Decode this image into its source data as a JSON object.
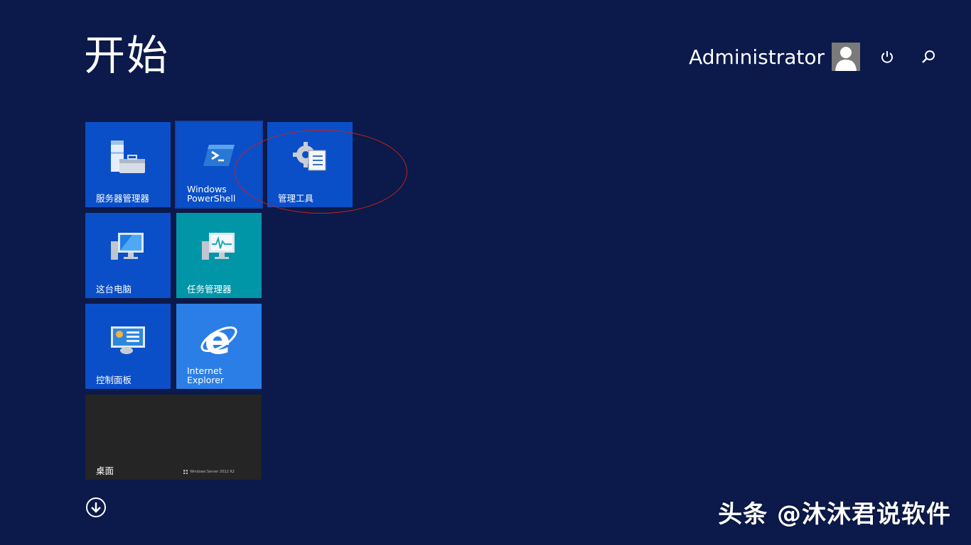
{
  "header": {
    "title": "开始",
    "username": "Administrator"
  },
  "tiles": [
    {
      "label": "服务器管理器",
      "icon": "server-manager-icon"
    },
    {
      "label": "Windows\nPowerShell",
      "icon": "powershell-icon"
    },
    {
      "label": "管理工具",
      "icon": "admin-tools-icon"
    },
    {
      "label": "这台电脑",
      "icon": "this-pc-icon"
    },
    {
      "label": "任务管理器",
      "icon": "task-manager-icon"
    },
    {
      "label": "控制面板",
      "icon": "control-panel-icon"
    },
    {
      "label": "Internet\nExplorer",
      "icon": "internet-explorer-icon"
    },
    {
      "label": "桌面",
      "badge": "Windows Server 2012 R2"
    }
  ],
  "watermark": "头条 @沐沐君说软件",
  "colors": {
    "background": "#0b1a4a",
    "tile_blue": "#0a4fc8",
    "tile_teal": "#0096a8",
    "tile_ie": "#2b7ee6",
    "tile_desktop": "#252525",
    "annotation_ring": "#c8201e"
  }
}
